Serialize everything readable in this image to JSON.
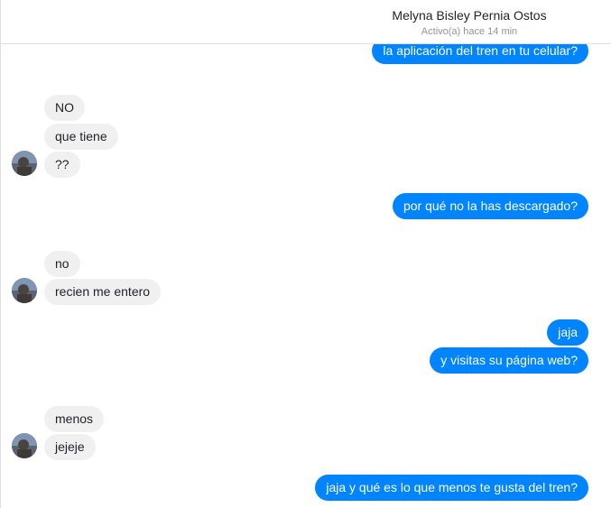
{
  "header": {
    "contact_name": "Melyna Bisley Pernia Ostos",
    "status": "Activo(a) hace 14 min"
  },
  "messages": [
    {
      "side": "out",
      "text": "la aplicación del tren en tu celular?"
    },
    {
      "side": "in",
      "text": "NO"
    },
    {
      "side": "in",
      "text": "que tiene"
    },
    {
      "side": "in",
      "text": "??"
    },
    {
      "side": "out",
      "text": "por qué no la has descargado?"
    },
    {
      "side": "in",
      "text": "no"
    },
    {
      "side": "in",
      "text": "recien me entero"
    },
    {
      "side": "out",
      "text": "jaja"
    },
    {
      "side": "out",
      "text": "y visitas su página web?"
    },
    {
      "side": "in",
      "text": "menos"
    },
    {
      "side": "in",
      "text": "jejeje"
    },
    {
      "side": "out",
      "text": "jaja y qué es lo que menos te gusta del tren?"
    }
  ],
  "colors": {
    "outgoing_bubble": "#0084ff",
    "incoming_bubble": "#f1f0f0"
  },
  "icons": {
    "avatar": "contact-avatar"
  }
}
